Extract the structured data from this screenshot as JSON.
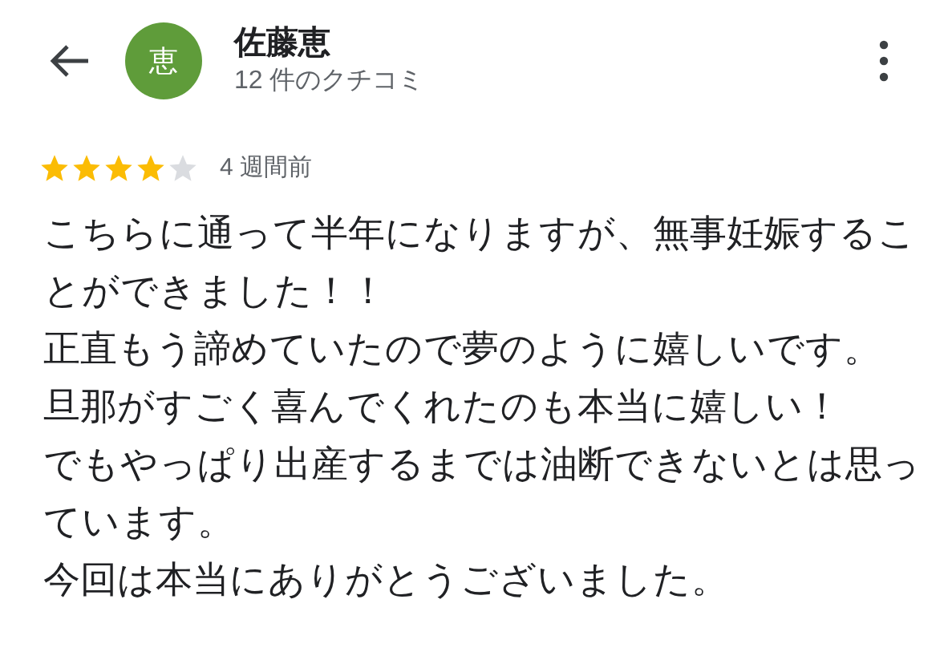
{
  "header": {
    "avatar_letter": "恵",
    "name": "佐藤恵",
    "review_count": "12 件のクチコミ"
  },
  "review": {
    "stars": 4,
    "time": "4 週間前",
    "paragraphs": [
      "こちらに通って半年になりますが、無事妊娠することができました！！",
      "正直もう諦めていたので夢のように嬉しいです。",
      "旦那がすごく喜んでくれたのも本当に嬉しい！",
      "でもやっぱり出産するまでは油断できないとは思っています。",
      "今回は本当にありがとうございました。"
    ]
  }
}
